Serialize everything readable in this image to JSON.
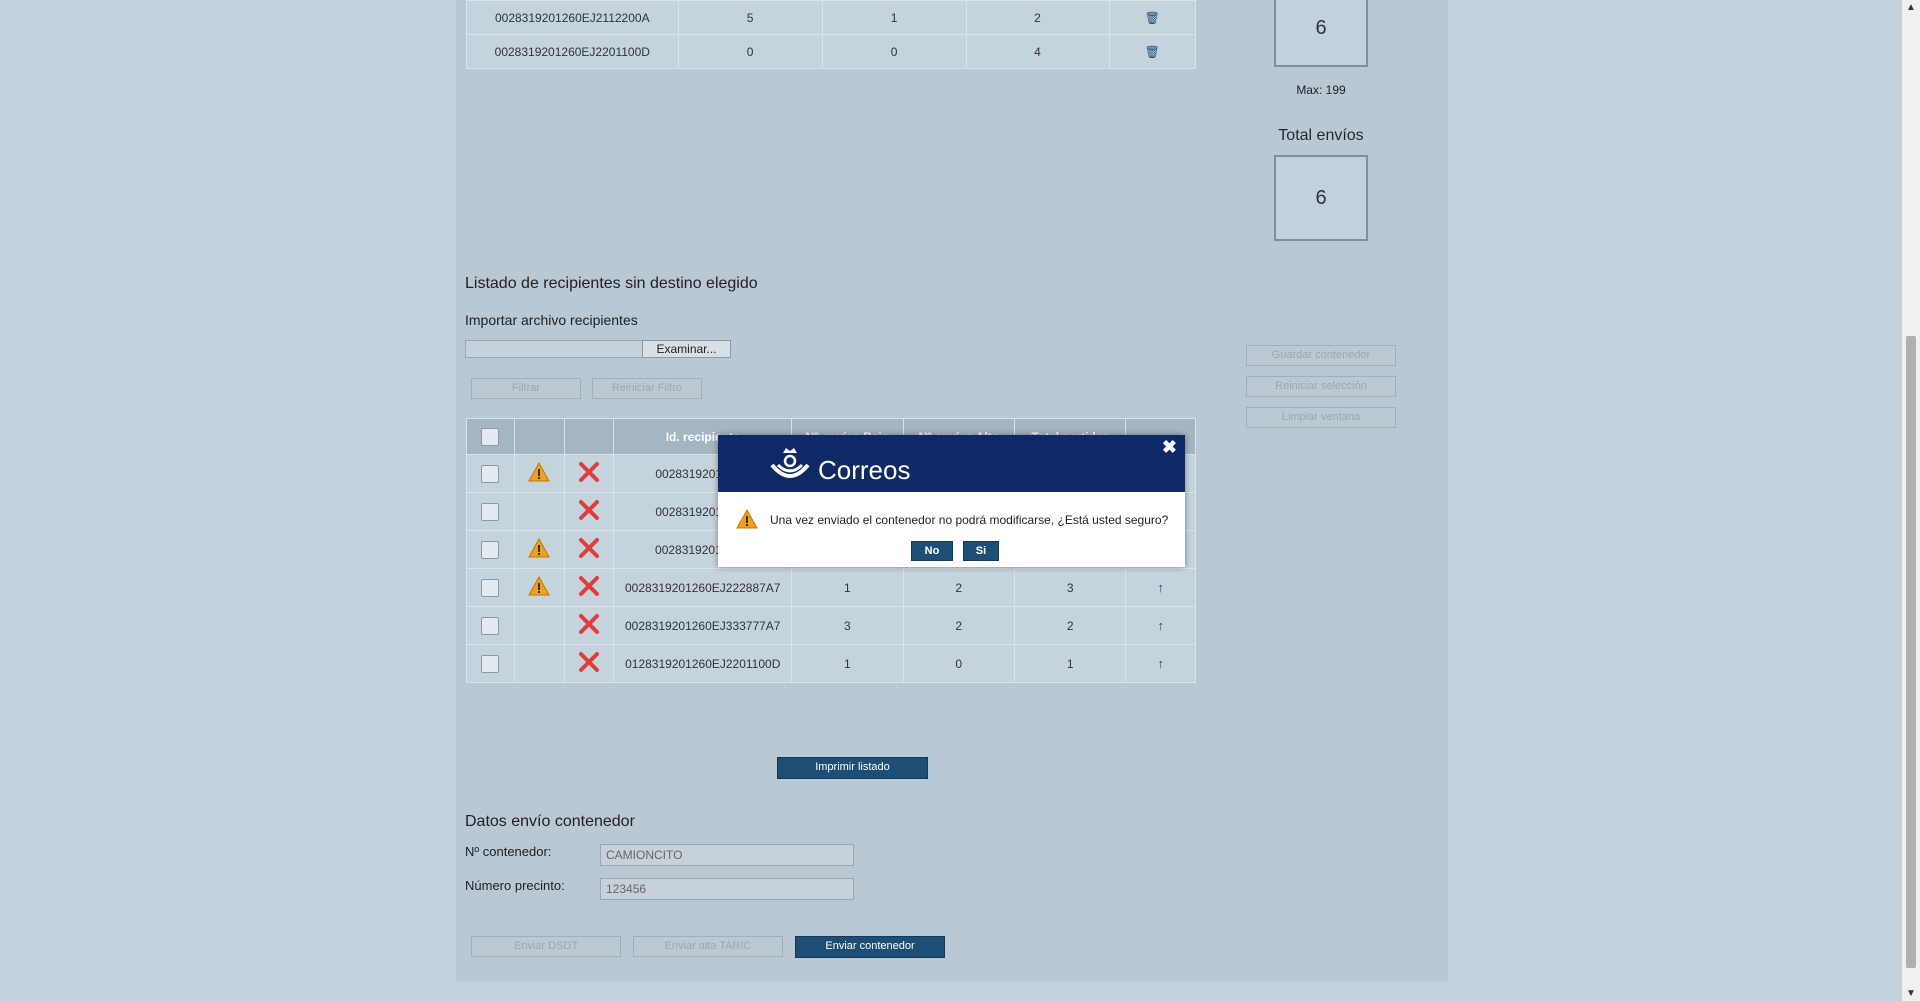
{
  "top_table": {
    "rows": [
      {
        "id": "0028319201260EJ2112200A",
        "c1": "5",
        "c2": "1",
        "c3": "2"
      },
      {
        "id": "0028319201260EJ2201100D",
        "c1": "0",
        "c2": "0",
        "c3": "4"
      }
    ]
  },
  "stats": {
    "containers_value": "6",
    "max_label": "Max: 199",
    "total_label": "Total envíos",
    "total_value": "6"
  },
  "list": {
    "title": "Listado de recipientes sin destino elegido",
    "import_label": "Importar archivo recipientes",
    "browse_label": "Examinar...",
    "filter_label": "Filtrar",
    "reset_filter_label": "Reiniciar Filtro",
    "headers": [
      "Id. recipiente",
      "Nº envíos Bajo",
      "Nº envíos Alto",
      "Total partidas"
    ],
    "rows": [
      {
        "id": "0028319201260E",
        "bajo": "",
        "alto": "",
        "total": "",
        "warn": true
      },
      {
        "id": "0028319201260E",
        "bajo": "",
        "alto": "",
        "total": "",
        "warn": false
      },
      {
        "id": "0028319201318H",
        "bajo": "",
        "alto": "",
        "total": "",
        "warn": true
      },
      {
        "id": "0028319201260EJ222887A7",
        "bajo": "1",
        "alto": "2",
        "total": "3",
        "warn": true
      },
      {
        "id": "0028319201260EJ333777A7",
        "bajo": "3",
        "alto": "2",
        "total": "2",
        "warn": false
      },
      {
        "id": "0128319201260EJ2201100D",
        "bajo": "1",
        "alto": "0",
        "total": "1",
        "warn": false
      }
    ]
  },
  "side_buttons": {
    "save": "Guardar contenedor",
    "reset_selection": "Reiniciar selección",
    "clear": "Limpiar ventana"
  },
  "print_label": "Imprimir listado",
  "container": {
    "title": "Datos envío contenedor",
    "number_label": "Nº contenedor:",
    "number_value": "CAMIONCITO",
    "seal_label": "Número precinto:",
    "seal_value": "123456"
  },
  "bottom_buttons": {
    "dsdt": "Enviar DSDT",
    "taric": "Enviar alta TARIC",
    "send": "Enviar contenedor"
  },
  "modal": {
    "brand": "Correos",
    "message": "Una vez enviado el contenedor no podrá modificarse, ¿Está usted seguro?",
    "no_label": "No",
    "yes_label": "Si"
  },
  "colors": {
    "modal_header": "#0e2a66",
    "button_dark": "#1d4f76",
    "delete_red": "#e03c3c",
    "warning_orange": "#f0a020"
  }
}
